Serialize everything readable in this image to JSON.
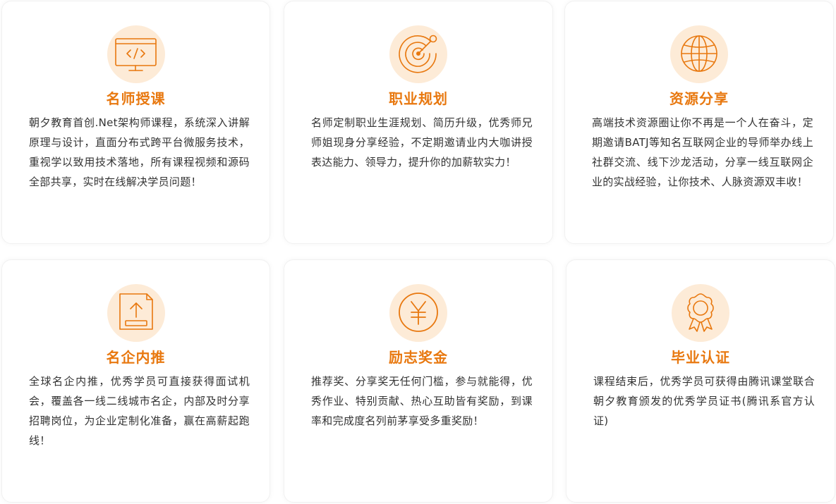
{
  "colors": {
    "accent": "#e8780f",
    "icon_bg": "#fdebd7",
    "text": "#333333"
  },
  "cards": [
    {
      "icon": "code-monitor-icon",
      "title": "名师授课",
      "desc": "朝夕教育首创.Net架构师课程，系统深入讲解原理与设计，直面分布式跨平台微服务技术，重视学以致用技术落地，所有课程视频和源码全部共享，实时在线解决学员问题！"
    },
    {
      "icon": "radar-target-icon",
      "title": "职业规划",
      "desc": "名师定制职业生涯规划、简历升级，优秀师兄师姐现身分享经验，不定期邀请业内大咖讲授表达能力、领导力，提升你的加薪软实力！"
    },
    {
      "icon": "globe-icon",
      "title": "资源分享",
      "desc": "高端技术资源圈让你不再是一个人在奋斗，定期邀请BATJ等知名互联网企业的导师举办线上社群交流、线下沙龙活动，分享一线互联网企业的实战经验，让你技术、人脉资源双丰收！"
    },
    {
      "icon": "document-upload-icon",
      "title": "名企内推",
      "desc": "全球名企内推，优秀学员可直接获得面试机会，覆盖各一线二线城市名企，内部及时分享招聘岗位，为企业定制化准备，赢在高薪起跑线！"
    },
    {
      "icon": "yuan-coin-icon",
      "title": "励志奖金",
      "desc": "推荐奖、分享奖无任何门槛，参与就能得，优秀作业、特别贡献、热心互助皆有奖励，到课率和完成度名列前茅享受多重奖励！"
    },
    {
      "icon": "award-badge-icon",
      "title": "毕业认证",
      "desc": "课程结束后，优秀学员可获得由腾讯课堂联合朝夕教育颁发的优秀学员证书(腾讯系官方认证)"
    }
  ]
}
